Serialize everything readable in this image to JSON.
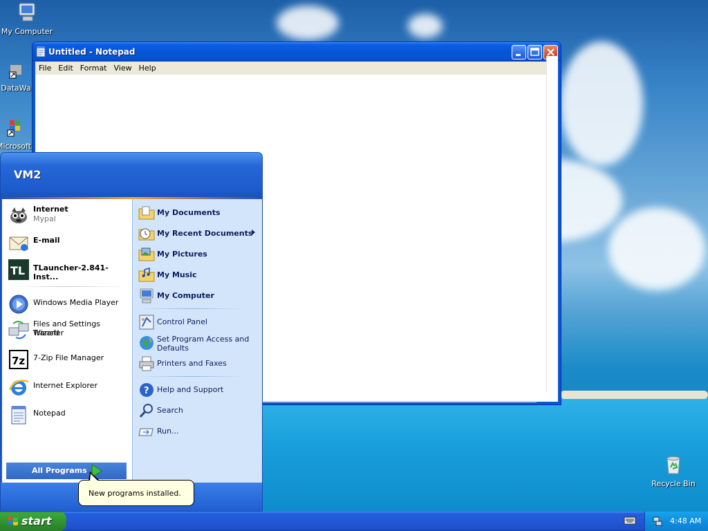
{
  "desktop": {
    "icons": [
      {
        "label": "My Computer",
        "icon": "my-computer-icon"
      },
      {
        "label": "DataWa",
        "icon": "shortcut-icon"
      },
      {
        "label": "Microsoft",
        "icon": "shortcut-icon"
      },
      {
        "label": "Recycle Bin",
        "icon": "recycle-bin-icon"
      }
    ]
  },
  "notepad": {
    "title": "Untitled - Notepad",
    "menu": [
      "File",
      "Edit",
      "Format",
      "View",
      "Help"
    ],
    "text": ""
  },
  "start_menu": {
    "user": "VM2",
    "pinned": [
      {
        "label": "Internet",
        "sub": "Mypal",
        "icon": "browser-icon"
      },
      {
        "label": "E-mail",
        "icon": "email-icon"
      },
      {
        "label": "TLauncher-2.841-Inst...",
        "icon": "tlauncher-icon"
      }
    ],
    "recent": [
      {
        "label": "Windows Media Player",
        "icon": "media-player-icon"
      },
      {
        "label": "Files and Settings Transfer",
        "label2": "Wizard",
        "icon": "transfer-wizard-icon"
      },
      {
        "label": "7-Zip File Manager",
        "icon": "7zip-icon"
      },
      {
        "label": "Internet Explorer",
        "icon": "internet-explorer-icon"
      },
      {
        "label": "Notepad",
        "icon": "notepad-icon"
      }
    ],
    "all_programs": "All Programs",
    "right": [
      {
        "label": "My Documents",
        "icon": "folder-icon"
      },
      {
        "label": "My Recent Documents",
        "icon": "recent-documents-icon"
      },
      {
        "label": "My Pictures",
        "icon": "pictures-icon"
      },
      {
        "label": "My Music",
        "icon": "music-icon"
      },
      {
        "label": "My Computer",
        "icon": "my-computer-icon"
      },
      {
        "label": "Control Panel",
        "icon": "control-panel-icon"
      },
      {
        "label": "Set Program Access and",
        "label2": "Defaults",
        "icon": "program-access-icon"
      },
      {
        "label": "Printers and Faxes",
        "icon": "printer-icon"
      },
      {
        "label": "Help and Support",
        "icon": "help-icon"
      },
      {
        "label": "Search",
        "icon": "search-icon"
      },
      {
        "label": "Run...",
        "icon": "run-icon"
      }
    ]
  },
  "balloon": {
    "text": "New programs installed."
  },
  "taskbar": {
    "start_label": "start",
    "clock": "4:48 AM"
  },
  "colors": {
    "taskbar": "#245edb",
    "start_button": "#3aa83a",
    "start_menu_right": "#d3e5fa",
    "balloon": "#ffffe1"
  }
}
